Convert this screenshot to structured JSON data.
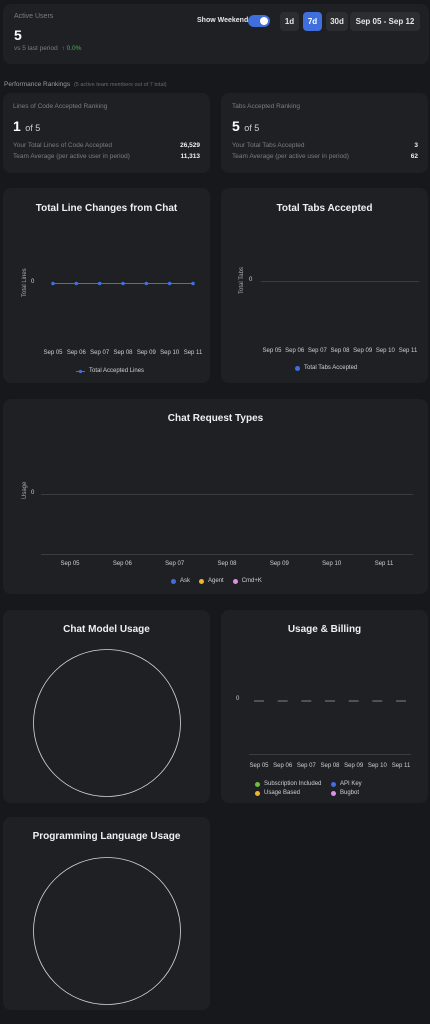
{
  "active_users": {
    "label": "Active Users",
    "value": "5",
    "comparison": "vs 5 last period",
    "change": "↑ 0.0%"
  },
  "controls": {
    "show_weekends_label": "Show Weekends",
    "show_weekends_on": true,
    "ranges": [
      "1d",
      "7d",
      "30d"
    ],
    "active_range": "7d",
    "date_range": "Sep 05 - Sep 12"
  },
  "rankings": {
    "title": "Performance Rankings",
    "subtitle": "(5 active team members out of 7 total)",
    "lines_card": {
      "title": "Lines of Code Accepted Ranking",
      "rank": "1",
      "of": "of 5",
      "rows": [
        {
          "label": "Your Total Lines of Code Accepted",
          "value": "26,529"
        },
        {
          "label": "Team Average (per active user in period)",
          "value": "11,313"
        }
      ]
    },
    "tabs_card": {
      "title": "Tabs Accepted Ranking",
      "rank": "5",
      "of": "of 5",
      "rows": [
        {
          "label": "Your Total Tabs Accepted",
          "value": "3"
        },
        {
          "label": "Team Average (per active user in period)",
          "value": "62"
        }
      ]
    }
  },
  "dates": [
    "Sep 05",
    "Sep 06",
    "Sep 07",
    "Sep 08",
    "Sep 09",
    "Sep 10",
    "Sep 11"
  ],
  "colors": {
    "blue": "#3f6fdc",
    "orange": "#f0b429",
    "pink": "#e08ee8",
    "green": "#6cbf3a",
    "up": "#4caf50"
  },
  "chart_data": [
    {
      "type": "line",
      "title": "Total Line Changes from Chat",
      "ylabel": "Total Lines",
      "categories": [
        "Sep 05",
        "Sep 06",
        "Sep 07",
        "Sep 08",
        "Sep 09",
        "Sep 10",
        "Sep 11"
      ],
      "y_ticks": [
        "0"
      ],
      "series": [
        {
          "name": "Total Accepted Lines",
          "values": [
            0,
            0,
            0,
            0,
            0,
            0,
            0
          ]
        }
      ]
    },
    {
      "type": "bar",
      "title": "Total Tabs Accepted",
      "ylabel": "Total Tabs",
      "categories": [
        "Sep 05",
        "Sep 06",
        "Sep 07",
        "Sep 08",
        "Sep 09",
        "Sep 10",
        "Sep 11"
      ],
      "y_ticks": [
        "0"
      ],
      "series": [
        {
          "name": "Total Tabs Accepted",
          "values": [
            0,
            0,
            0,
            0,
            0,
            0,
            0
          ]
        }
      ]
    },
    {
      "type": "bar",
      "title": "Chat Request Types",
      "ylabel": "Usage",
      "categories": [
        "Sep 05",
        "Sep 06",
        "Sep 07",
        "Sep 08",
        "Sep 09",
        "Sep 10",
        "Sep 11"
      ],
      "y_ticks": [
        "0"
      ],
      "series": [
        {
          "name": "Ask",
          "values": [
            0,
            0,
            0,
            0,
            0,
            0,
            0
          ]
        },
        {
          "name": "Agent",
          "values": [
            0,
            0,
            0,
            0,
            0,
            0,
            0
          ]
        },
        {
          "name": "Cmd+K",
          "values": [
            0,
            0,
            0,
            0,
            0,
            0,
            0
          ]
        }
      ]
    },
    {
      "type": "pie",
      "title": "Chat Model Usage",
      "values": []
    },
    {
      "type": "bar",
      "title": "Usage & Billing",
      "categories": [
        "Sep 05",
        "Sep 06",
        "Sep 07",
        "Sep 08",
        "Sep 09",
        "Sep 10",
        "Sep 11"
      ],
      "y_ticks": [
        "0"
      ],
      "series": [
        {
          "name": "Subscription Included",
          "values": [
            0,
            0,
            0,
            0,
            0,
            0,
            0
          ]
        },
        {
          "name": "API Key",
          "values": [
            0,
            0,
            0,
            0,
            0,
            0,
            0
          ]
        },
        {
          "name": "Usage Based",
          "values": [
            0,
            0,
            0,
            0,
            0,
            0,
            0
          ]
        },
        {
          "name": "Bugbot",
          "values": [
            0,
            0,
            0,
            0,
            0,
            0,
            0
          ]
        }
      ]
    },
    {
      "type": "pie",
      "title": "Programming Language Usage",
      "values": []
    }
  ]
}
